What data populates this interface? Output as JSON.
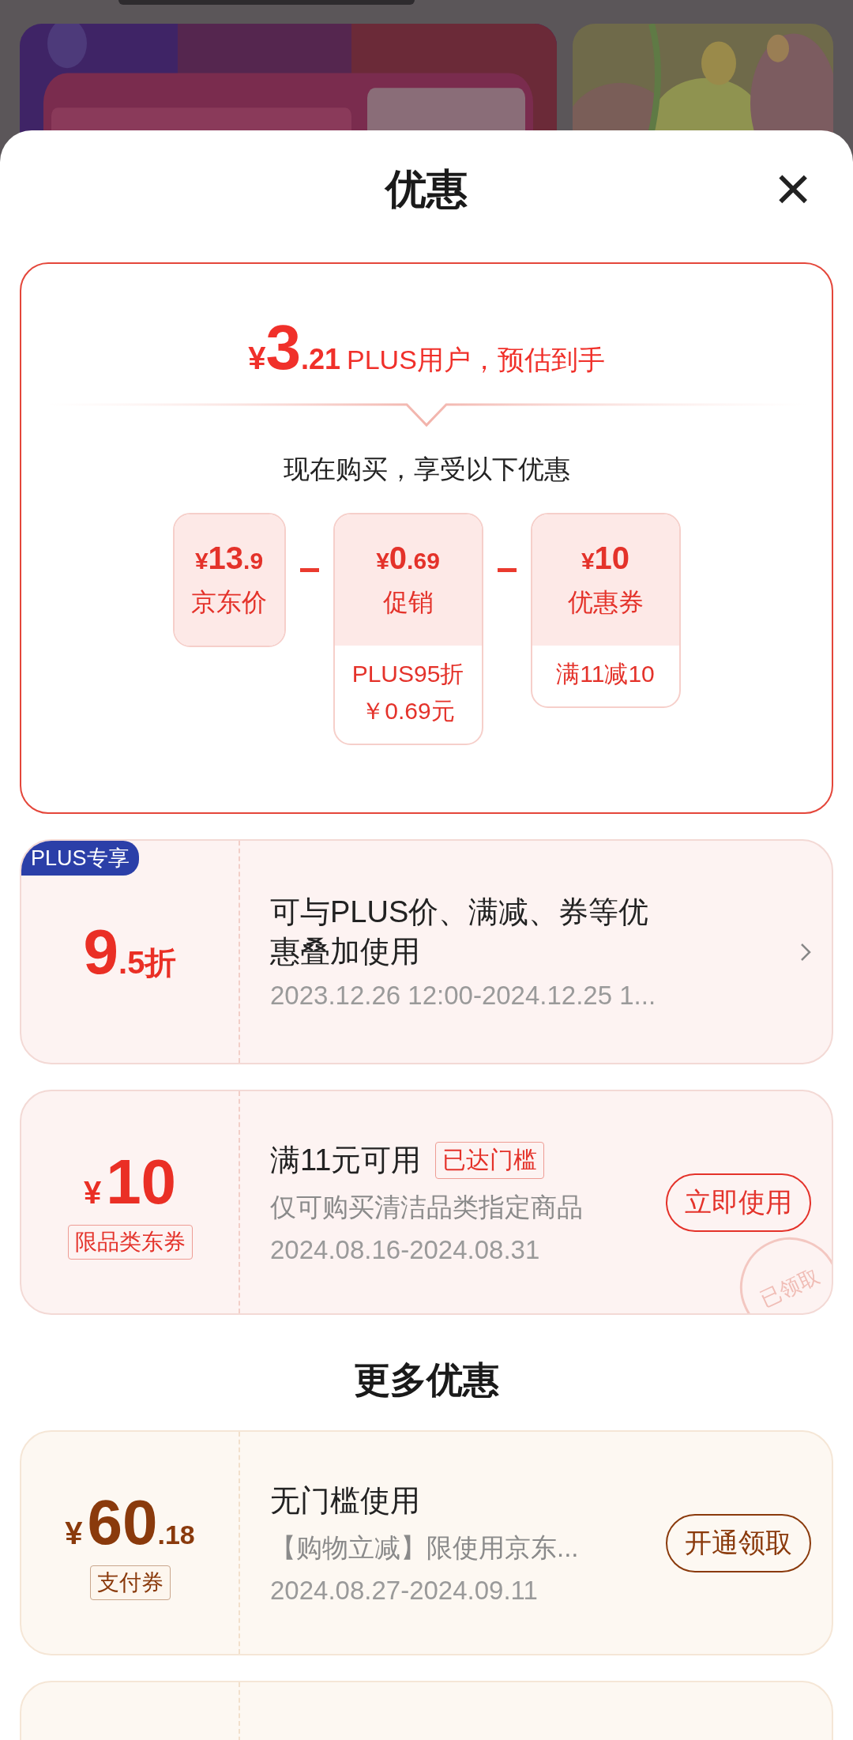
{
  "sheet": {
    "title": "优惠",
    "close": "×"
  },
  "summary": {
    "currency": "¥",
    "price_int": "3",
    "price_dec": ".21",
    "caption": "PLUS用户，预估到手",
    "subtitle": "现在购买，享受以下优惠",
    "parts": [
      {
        "currency": "¥",
        "int": "13",
        "dec": ".9",
        "label": "京东价"
      },
      {
        "currency": "¥",
        "int": "0",
        "dec": ".69",
        "label": "促销",
        "details": [
          "PLUS95折",
          "￥0.69元"
        ]
      },
      {
        "currency": "¥",
        "int": "10",
        "label": "优惠券",
        "details": [
          "满11减10"
        ]
      }
    ]
  },
  "coupons": [
    {
      "kind": "discount",
      "badge": "PLUS专享",
      "amount_int": "9",
      "amount_dec": ".5折",
      "title": "可与PLUS价、满减、券等优惠叠加使用",
      "dates": "2023.12.26 12:00-2024.12.25 1..."
    },
    {
      "kind": "cash",
      "currency": "¥",
      "amount_int": "10",
      "tag": "限品类东券",
      "title": "满11元可用",
      "threshold": "已达门槛",
      "description": "仅可购买清洁品类指定商品",
      "dates": "2024.08.16-2024.08.31",
      "button": "立即使用",
      "stamp": "已领取"
    }
  ],
  "more": {
    "heading": "更多优惠",
    "coupons": [
      {
        "kind": "cash",
        "currency": "¥",
        "amount_int": "60",
        "amount_dec": ".18",
        "tag": "支付券",
        "title": "无门槛使用",
        "description": "【购物立减】限使用京东...",
        "dates": "2024.08.27-2024.09.11",
        "button": "开通领取"
      },
      {
        "kind": "partial"
      }
    ]
  }
}
